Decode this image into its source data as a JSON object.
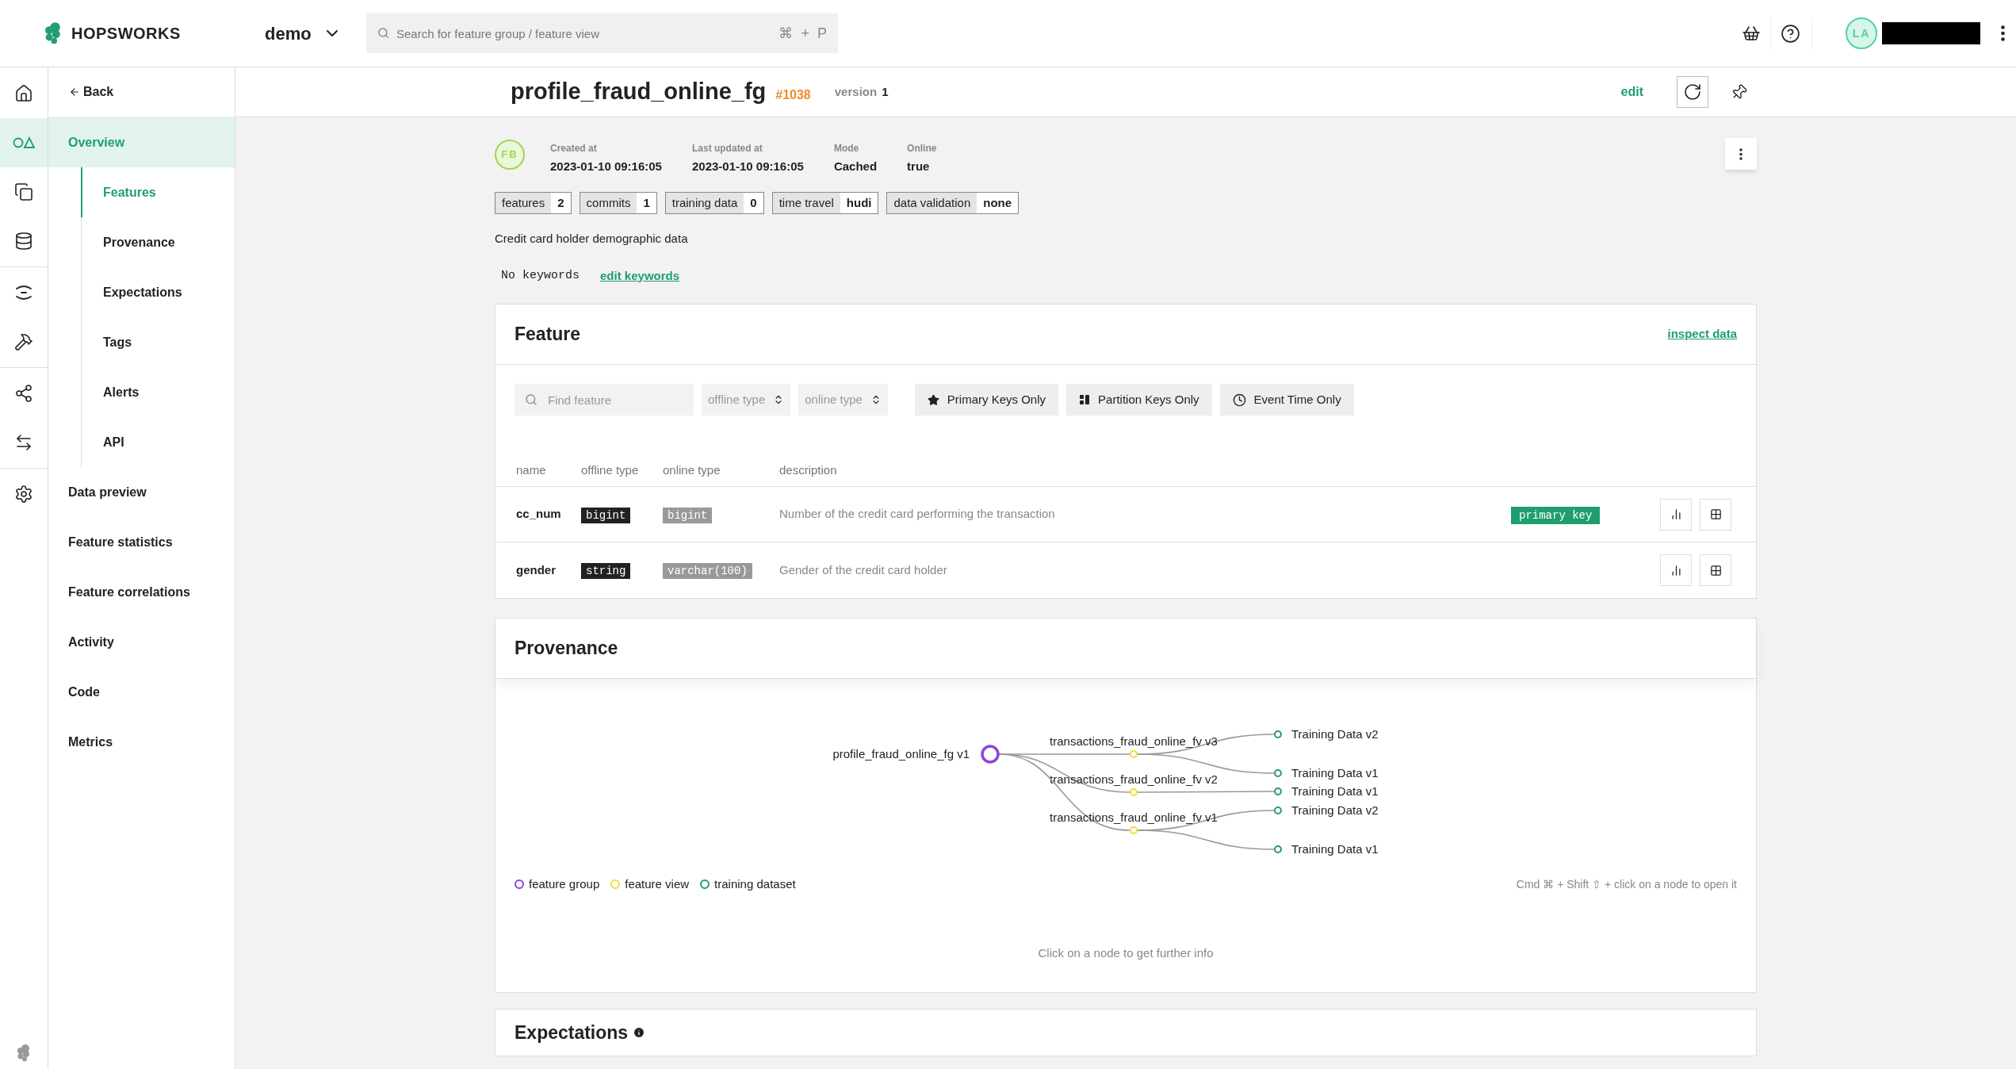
{
  "topbar": {
    "logo": "HOPSWORKS",
    "project": "demo",
    "search": {
      "placeholder": "Search for feature group / feature view",
      "shortcut": [
        "⌘",
        "+",
        "P"
      ]
    },
    "avatar": "LA"
  },
  "rail": [
    {
      "kind": "home",
      "selected": false
    },
    {
      "kind": "shapes",
      "selected": true
    },
    {
      "kind": "copy",
      "selected": false
    },
    {
      "kind": "database",
      "selected": false
    },
    {
      "kind": "arcs",
      "selected": false
    },
    {
      "kind": "hammer",
      "selected": false
    },
    {
      "kind": "nodes",
      "selected": false
    },
    {
      "kind": "arrows",
      "selected": false
    },
    {
      "kind": "settings",
      "selected": false
    }
  ],
  "nav": {
    "back": "Back",
    "items": [
      {
        "label": "Overview",
        "selected": true,
        "children": [
          {
            "label": "Features",
            "selected": true
          },
          {
            "label": "Provenance",
            "selected": false
          },
          {
            "label": "Expectations",
            "selected": false
          },
          {
            "label": "Tags",
            "selected": false
          },
          {
            "label": "Alerts",
            "selected": false
          },
          {
            "label": "API",
            "selected": false
          }
        ]
      },
      {
        "label": "Data preview",
        "selected": false
      },
      {
        "label": "Feature statistics",
        "selected": false
      },
      {
        "label": "Feature correlations",
        "selected": false
      },
      {
        "label": "Activity",
        "selected": false
      },
      {
        "label": "Code",
        "selected": false
      },
      {
        "label": "Metrics",
        "selected": false
      }
    ]
  },
  "header": {
    "title": "profile_fraud_online_fg",
    "id": "#1038",
    "version_label": "version",
    "version": "1",
    "edit": "edit"
  },
  "meta": {
    "avatar": "FB",
    "fields": [
      {
        "label": "Created at",
        "value": "2023-01-10 09:16:05"
      },
      {
        "label": "Last updated at",
        "value": "2023-01-10 09:16:05"
      },
      {
        "label": "Mode",
        "value": "Cached"
      },
      {
        "label": "Online",
        "value": "true"
      }
    ]
  },
  "badges": [
    {
      "label": "features",
      "value": "2"
    },
    {
      "label": "commits",
      "value": "1"
    },
    {
      "label": "training data",
      "value": "0"
    },
    {
      "label": "time travel",
      "value": "hudi"
    },
    {
      "label": "data validation",
      "value": "none"
    }
  ],
  "description": "Credit card holder demographic data",
  "keywords": {
    "text": "No keywords",
    "link": "edit keywords"
  },
  "feature": {
    "title": "Feature",
    "link": "inspect data",
    "search_placeholder": "Find feature",
    "selects": [
      "offline type",
      "online type"
    ],
    "filters": [
      {
        "kind": "star",
        "label": "Primary Keys Only"
      },
      {
        "kind": "partition",
        "label": "Partition Keys Only"
      },
      {
        "kind": "clock",
        "label": "Event Time Only"
      }
    ],
    "columns": [
      "name",
      "offline type",
      "online type",
      "description"
    ],
    "rows": [
      {
        "name": "cc_num",
        "offline_type": "bigint",
        "online_type": "bigint",
        "description": "Number of the credit card performing the transaction",
        "tag": "primary key"
      },
      {
        "name": "gender",
        "offline_type": "string",
        "online_type": "varchar(100)",
        "description": "Gender of the credit card holder"
      }
    ]
  },
  "provenance": {
    "title": "Provenance",
    "feature_group": "profile_fraud_online_fg v1",
    "feature_views": [
      {
        "label": "transactions_fraud_online_fv v3",
        "children": [
          "Training Data v2",
          "Training Data v1"
        ]
      },
      {
        "label": "transactions_fraud_online_fv v2",
        "children": [
          "Training Data v1"
        ]
      },
      {
        "label": "transactions_fraud_online_fv v1",
        "children": [
          "Training Data v2",
          "Training Data v1"
        ]
      }
    ],
    "legend": [
      {
        "label": "feature group",
        "color": "#8c44db"
      },
      {
        "label": "feature view",
        "color": "#f0de2a"
      },
      {
        "label": "training dataset",
        "color": "#1f9e6e"
      }
    ],
    "hint": "Cmd ⌘ + Shift ⇧ + click on a node to open it",
    "footer": "Click on a node to get further info"
  },
  "expectations": {
    "title": "Expectations"
  }
}
